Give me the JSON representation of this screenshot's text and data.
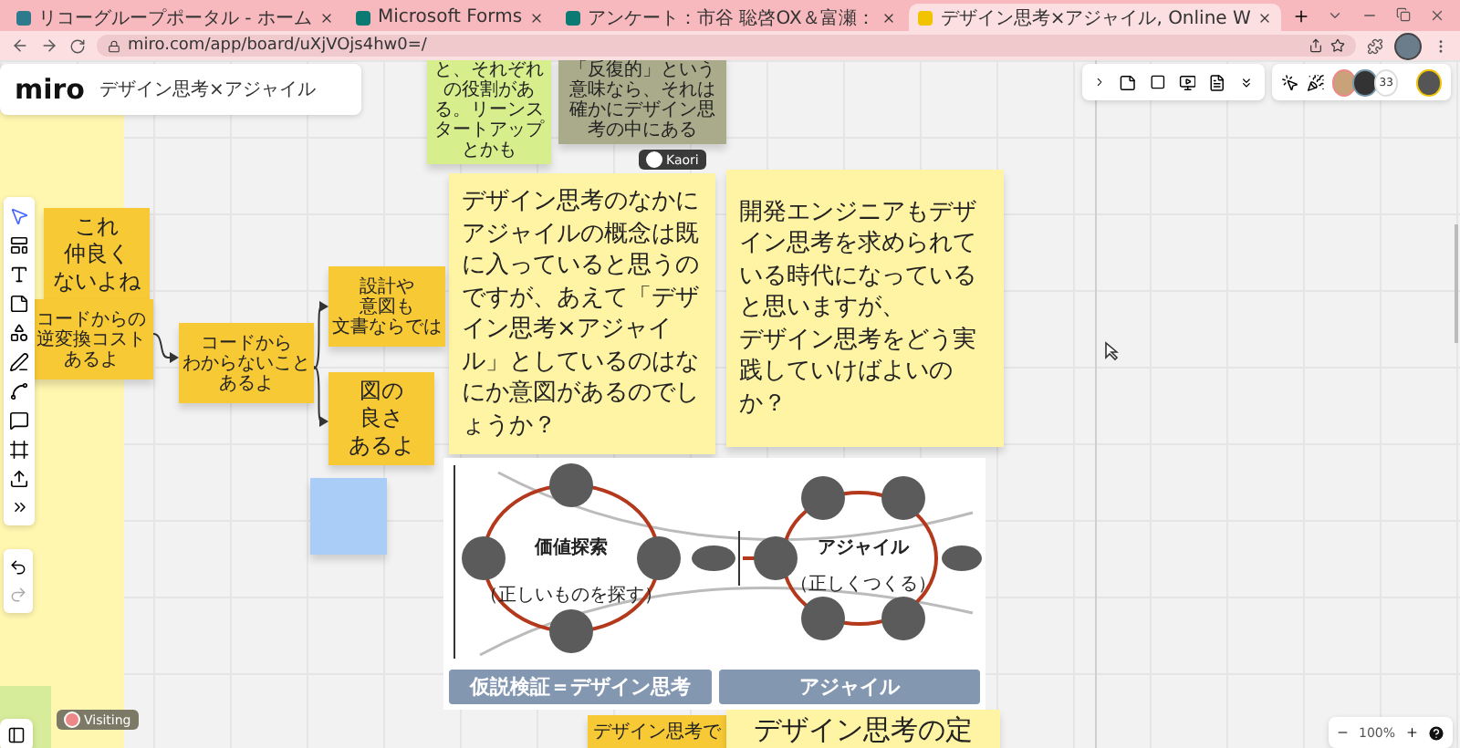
{
  "browser": {
    "tabs": [
      {
        "title": "リコーグループポータル - ホーム",
        "selected": false,
        "color": "#2c7a8c"
      },
      {
        "title": "Microsoft Forms",
        "selected": false,
        "color": "#0b7a73"
      },
      {
        "title": "アンケート：市谷 聡啓OX＆富瀬：",
        "selected": false,
        "color": "#0b7a73"
      },
      {
        "title": "デザイン思考×アジャイル, Online W",
        "selected": true,
        "color": "#f2c400"
      }
    ],
    "address": "miro.com/app/board/uXjVOjs4hw0=/"
  },
  "board": {
    "logo": "miro",
    "title": "デザイン思考×アジャイル",
    "collaborator_count": "33",
    "zoom": "100%"
  },
  "stickies": [
    {
      "kind": "small",
      "color": "#d6ee8c",
      "text": "と、それぞれの役割がある。リーンスタートアップとかも"
    },
    {
      "kind": "small",
      "color": "#a9ab8b",
      "text": "「反復的」という意味なら、それは確かにデザイン思考の中にある"
    },
    {
      "kind": "large",
      "color": "#fff4a3",
      "text": "デザイン思考のなかにアジャイルの概念は既に入っていると思うのですが、あえて「デザイン思考×アジャイル」としているのはなにか意図があるのでしょうか？"
    },
    {
      "kind": "large",
      "color": "#fff4a3",
      "lines": [
        "開発エンジニアもデザイン思考を求められている時代になっていると思いますが、",
        "デザイン思考をどう実践していけばよいのか？"
      ]
    },
    {
      "kind": "medium",
      "color": "#f6c935",
      "lines": [
        "これ",
        "仲良く",
        "ないよね"
      ]
    },
    {
      "kind": "small",
      "color": "#f6c935",
      "lines": [
        "コードからの",
        "逆変換コスト",
        "あるよ"
      ]
    },
    {
      "kind": "small",
      "color": "#f6c935",
      "lines": [
        "コードから",
        "わからないこと",
        "あるよ"
      ]
    },
    {
      "kind": "small",
      "color": "#f6c935",
      "lines": [
        "設計や",
        "意図も",
        "文書ならでは"
      ]
    },
    {
      "kind": "medium",
      "color": "#f6c935",
      "lines": [
        "図の",
        "良さ",
        "あるよ"
      ]
    },
    {
      "kind": "small",
      "color": "#a9cdf6"
    },
    {
      "kind": "small",
      "color": "#f6c935",
      "text": "デザイン思考で"
    },
    {
      "kind": "heading",
      "color": "#fff4a3",
      "text": "デザイン思考の定"
    }
  ],
  "badges": [
    {
      "kind": "author",
      "label": "Kaori"
    },
    {
      "kind": "visiting",
      "label": "Visiting"
    }
  ],
  "diagram": {
    "loops": [
      {
        "title": "価値探索",
        "subtitle": "（正しいものを探す）"
      },
      {
        "title": "アジャイル",
        "subtitle": "（正しくつくる）"
      }
    ],
    "banners": [
      "仮説検証＝デザイン思考",
      "アジャイル"
    ]
  }
}
